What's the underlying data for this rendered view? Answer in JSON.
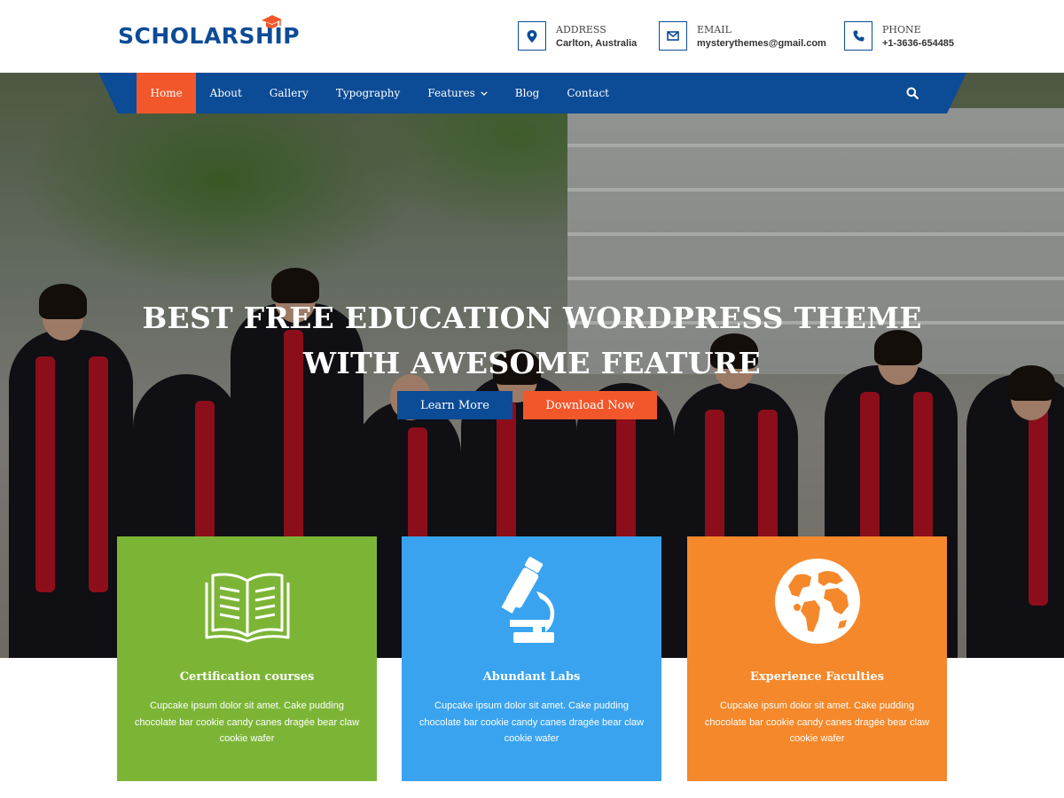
{
  "brand": {
    "name": "SCHOLARSHIP",
    "logo_icon": "graduation-cap-icon"
  },
  "contacts": [
    {
      "label": "ADDRESS",
      "value": "Carlton, Australia",
      "icon": "map-marker-icon"
    },
    {
      "label": "EMAIL",
      "value": "mysterythemes@gmail.com",
      "icon": "envelope-icon"
    },
    {
      "label": "PHONE",
      "value": "+1-3636-654485",
      "icon": "phone-icon"
    }
  ],
  "nav": {
    "items": [
      {
        "label": "Home",
        "active": true
      },
      {
        "label": "About"
      },
      {
        "label": "Gallery"
      },
      {
        "label": "Typography"
      },
      {
        "label": "Features",
        "has_dropdown": true
      },
      {
        "label": "Blog"
      },
      {
        "label": "Contact"
      }
    ],
    "search_icon": "search-icon"
  },
  "hero": {
    "title": "BEST FREE EDUCATION WORDPRESS THEME WITH AWESOME FEATURE",
    "primary_button": "Learn More",
    "secondary_button": "Download Now"
  },
  "features": [
    {
      "title": "Certification courses",
      "text": "Cupcake ipsum dolor sit amet. Cake pudding chocolate bar cookie candy canes dragée bear claw cookie wafer",
      "icon": "open-book-icon",
      "color": "#7cb536"
    },
    {
      "title": "Abundant Labs",
      "text": "Cupcake ipsum dolor sit amet. Cake pudding chocolate bar cookie candy canes dragée bear claw cookie wafer",
      "icon": "microscope-icon",
      "color": "#39a3f0"
    },
    {
      "title": "Experience Faculties",
      "text": "Cupcake ipsum dolor sit amet. Cake pudding chocolate bar cookie candy canes dragée bear claw cookie wafer",
      "icon": "globe-icon",
      "color": "#f4882a"
    }
  ],
  "colors": {
    "primary": "#0c4b96",
    "accent": "#f2572b"
  }
}
